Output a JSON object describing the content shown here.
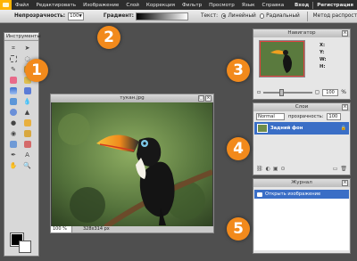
{
  "menubar": {
    "items": [
      "Файл",
      "Редактировать",
      "Изображение",
      "Слой",
      "Коррекция",
      "Фильтр",
      "Просмотр",
      "Язык",
      "Справка"
    ],
    "right": [
      "Вход",
      "Регистрация"
    ]
  },
  "options": {
    "opacity_label": "Непрозрачность:",
    "opacity_value": "100",
    "gradient_label": "Градиент:",
    "text_label": "Текст:",
    "linear_label": "Линейный",
    "radial_label": "Радиальный",
    "method_label": "Метод распрост"
  },
  "toolbox": {
    "title": "Инструменты"
  },
  "image_window": {
    "title": "тукан.jpg",
    "zoom": "100 %",
    "dims": "328x314 px"
  },
  "navigator": {
    "title": "Навигатор",
    "x_label": "X:",
    "y_label": "Y:",
    "w_label": "W:",
    "h_label": "H:",
    "zoom_value": "100",
    "zoom_unit": "%"
  },
  "layers": {
    "title": "Слои",
    "blend_mode": "Normal",
    "opacity_label": "прозрачность:",
    "opacity_value": "100",
    "layer_name": "Задний фон"
  },
  "history": {
    "title": "Журнал",
    "entry": "Открыть изображение"
  },
  "callouts": [
    "1",
    "2",
    "3",
    "4",
    "5"
  ]
}
